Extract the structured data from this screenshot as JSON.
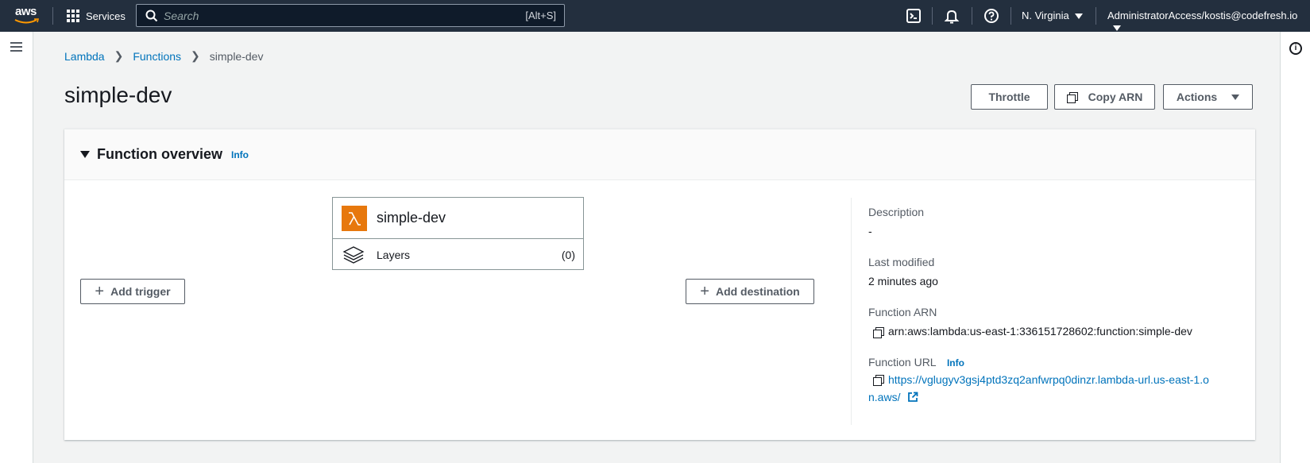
{
  "topbar": {
    "logo_text": "aws",
    "services_label": "Services",
    "search_placeholder": "Search",
    "search_shortcut": "[Alt+S]",
    "region": "N. Virginia",
    "account": "AdministratorAccess/kostis@codefresh.io",
    "icons": [
      "cloudshell-icon",
      "notifications-icon",
      "help-icon"
    ]
  },
  "breadcrumb": {
    "items": [
      "Lambda",
      "Functions"
    ],
    "current": "simple-dev"
  },
  "page": {
    "title": "simple-dev",
    "buttons": {
      "throttle": "Throttle",
      "copy_arn": "Copy ARN",
      "actions": "Actions"
    }
  },
  "overview": {
    "title": "Function overview",
    "info": "Info",
    "function_name": "simple-dev",
    "layers_label": "Layers",
    "layers_count": "(0)",
    "add_trigger": "Add trigger",
    "add_destination": "Add destination",
    "description_label": "Description",
    "description_value": "-",
    "last_modified_label": "Last modified",
    "last_modified_value": "2 minutes ago",
    "arn_label": "Function ARN",
    "arn_value": "arn:aws:lambda:us-east-1:336151728602:function:simple-dev",
    "url_label": "Function URL",
    "url_info": "Info",
    "url_line1": "https://vglugyv3gsj4ptd3zq2anfwrpq0dinzr.lambda-url.us-east-1.o",
    "url_line2": "n.aws/"
  },
  "colors": {
    "topbar_bg": "#232f3e",
    "link": "#0073bb",
    "lambda_orange": "#e7780d"
  }
}
